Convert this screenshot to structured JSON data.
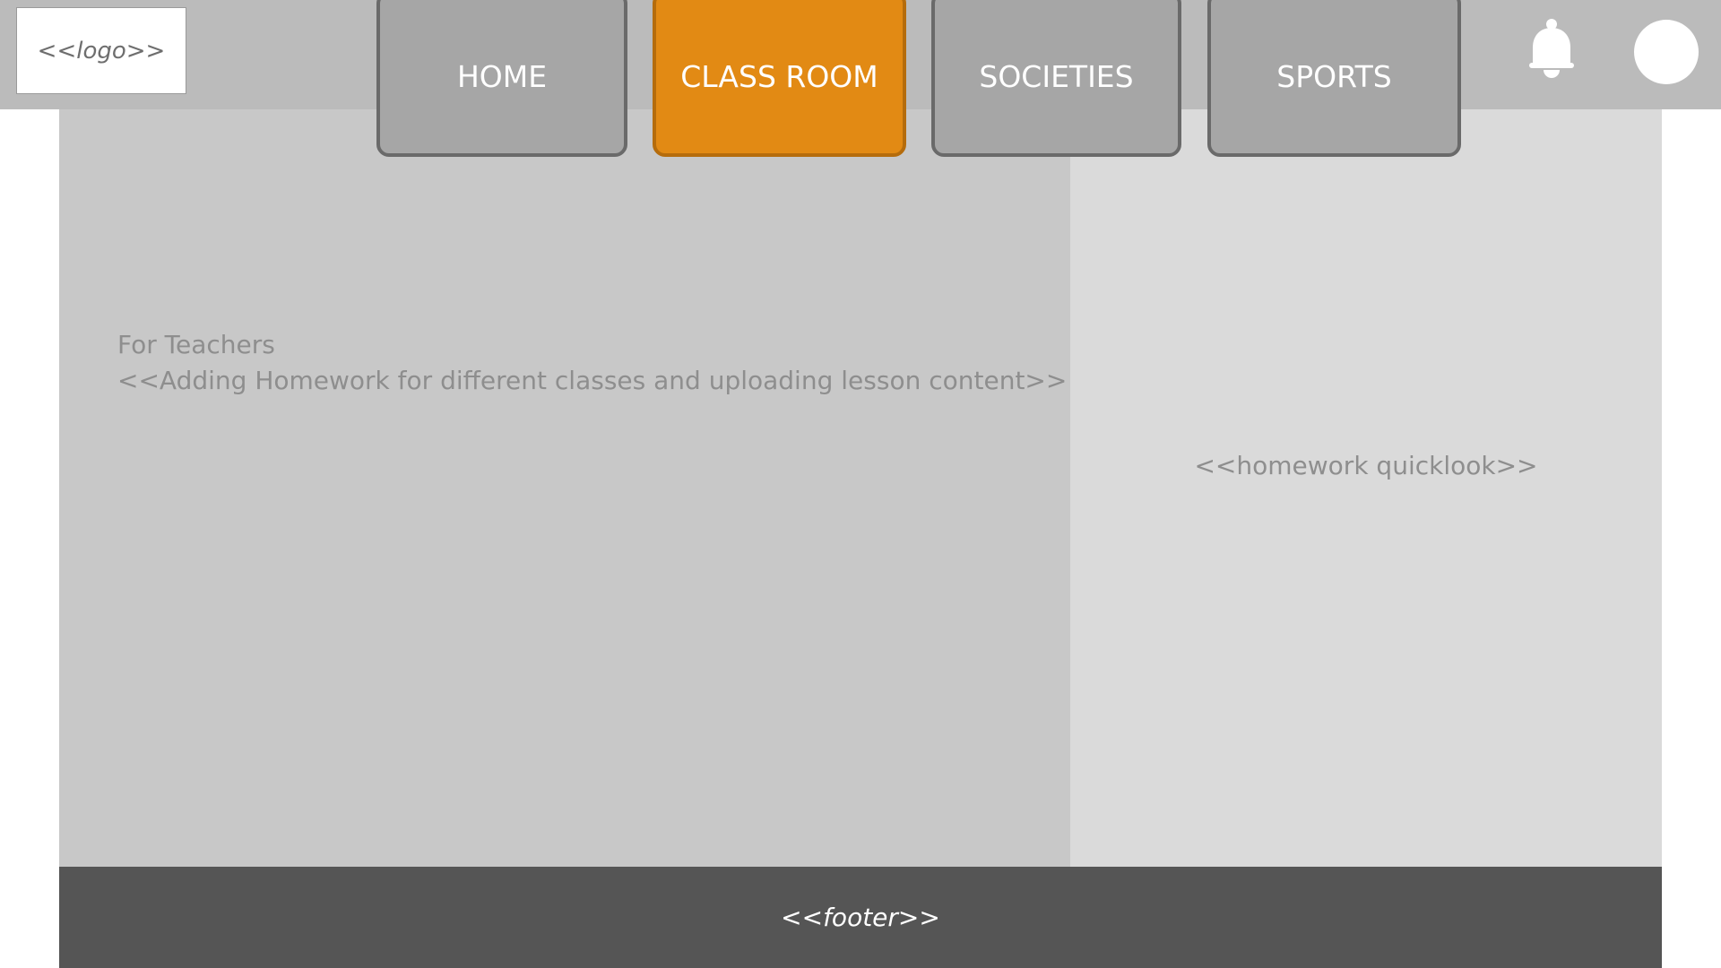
{
  "header": {
    "logo_text": "<<logo>>",
    "icons": {
      "notifications": "bell-icon",
      "profile": "avatar"
    }
  },
  "nav": {
    "tabs": [
      {
        "label": "HOME",
        "active": false
      },
      {
        "label": "CLASS ROOM",
        "active": true
      },
      {
        "label": "SOCIETIES",
        "active": false
      },
      {
        "label": "SPORTS",
        "active": false
      }
    ]
  },
  "main": {
    "title": "For Teachers",
    "description": "<<Adding Homework for different classes and uploading lesson content>>"
  },
  "sidebar": {
    "placeholder": "<<homework quicklook>>"
  },
  "footer": {
    "text": "<<footer>>"
  },
  "colors": {
    "header": "#bbbbbb",
    "tab": "#a6a6a6",
    "tab_active": "#e28a14",
    "main": "#c8c8c8",
    "sidebar": "#dadada",
    "footer": "#555555"
  }
}
